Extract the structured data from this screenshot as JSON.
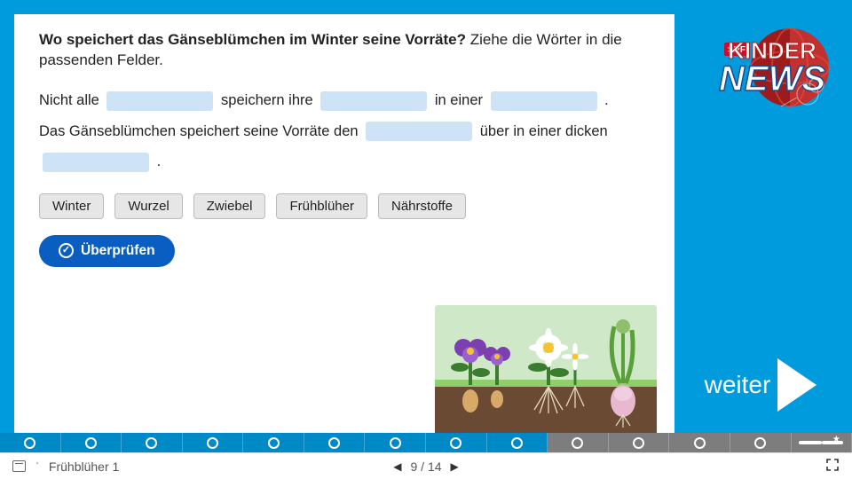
{
  "question": {
    "bold": "Wo speichert das Gänseblümchen im Winter seine Vorräte?",
    "rest": " Ziehe die Wörter in die passenden Felder."
  },
  "cloze": {
    "t1": "Nicht alle ",
    "t2": " speichern ihre ",
    "t3": " in einer ",
    "t4": ".",
    "t5": "Das Gänseblümchen speichert seine Vorräte den ",
    "t6": " über in einer dicken ",
    "t7": "."
  },
  "words": [
    "Winter",
    "Wurzel",
    "Zwiebel",
    "Frühblüher",
    "Nährstoffe"
  ],
  "check_label": "Überprüfen",
  "logo": {
    "brand": "SRF",
    "line1": "KINDER",
    "line2": "NEWS"
  },
  "weiter_label": "weiter",
  "progress": {
    "cells": [
      {
        "state": "done"
      },
      {
        "state": "done"
      },
      {
        "state": "done"
      },
      {
        "state": "done"
      },
      {
        "state": "done"
      },
      {
        "state": "done"
      },
      {
        "state": "done"
      },
      {
        "state": "done"
      },
      {
        "state": "active"
      },
      {
        "state": "future"
      },
      {
        "state": "future"
      },
      {
        "state": "future"
      },
      {
        "state": "future"
      },
      {
        "state": "future",
        "last": true
      }
    ]
  },
  "footer": {
    "title": "Frühblüher 1",
    "page_current": "9",
    "page_sep": " / ",
    "page_total": "14"
  }
}
